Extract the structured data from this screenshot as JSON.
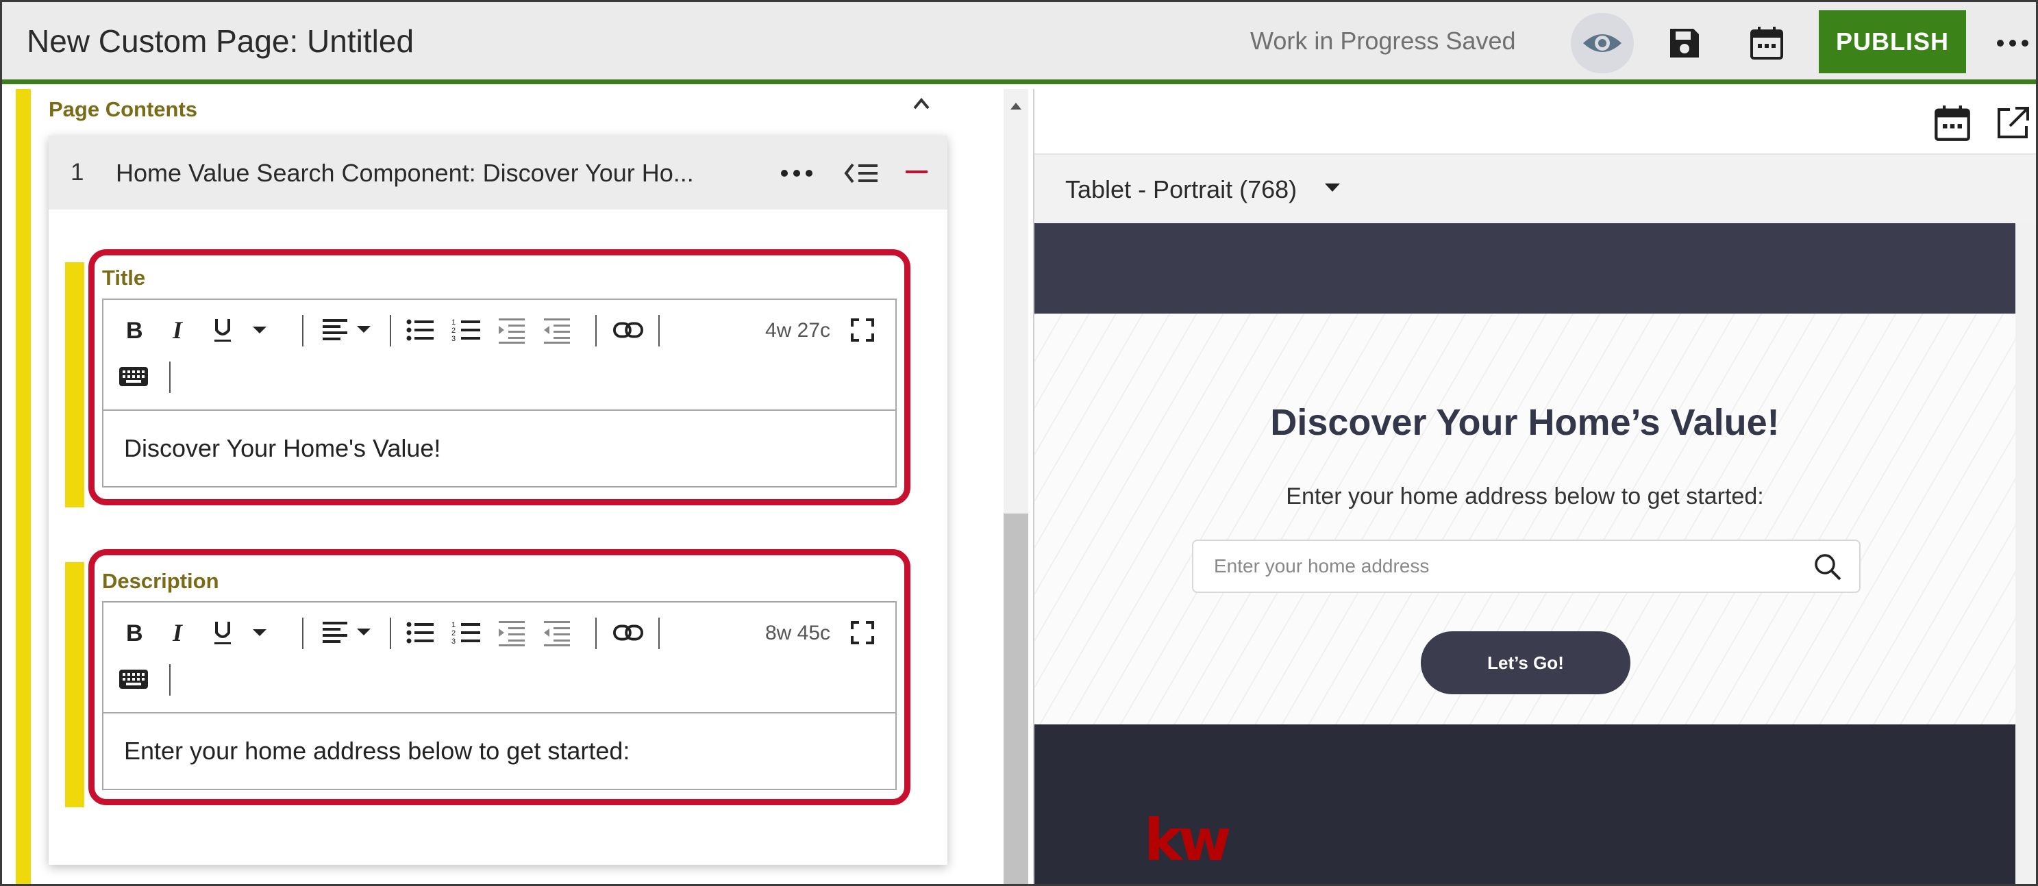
{
  "header": {
    "title": "New Custom Page: Untitled",
    "status": "Work in Progress Saved",
    "publish_label": "PUBLISH",
    "icons": [
      "eye-icon",
      "save-icon",
      "calendar-icon",
      "more-icon"
    ],
    "colors": {
      "publish": "#3b8319",
      "underline": "#3d7d1e"
    }
  },
  "editor_panel": {
    "section_label": "Page Contents",
    "component": {
      "number": "1",
      "title": "Home Value Search Component: Discover Your Ho..."
    },
    "fields": [
      {
        "label": "Title",
        "count": "4w 27c",
        "value": "Discover Your Home's Value!"
      },
      {
        "label": "Description",
        "count": "8w 45c",
        "value": "Enter your home address below to get started:"
      }
    ],
    "toolbar_tools": [
      "bold",
      "italic",
      "underline",
      "more-format",
      "align",
      "bulleted-list",
      "numbered-list",
      "indent",
      "outdent",
      "link",
      "keyboard",
      "fullscreen"
    ],
    "colors": {
      "accent": "#f0d90b",
      "highlight_box": "#c8102e"
    }
  },
  "preview_panel": {
    "device": "Tablet - Portrait (768)",
    "heading": "Discover Your Home’s Value!",
    "subheading": "Enter your home address below to get started:",
    "search_placeholder": "Enter your home address",
    "button_label": "Let’s Go!",
    "logo_text": "kw",
    "colors": {
      "dark": "#3b3d4e",
      "logo": "#b40101"
    }
  }
}
